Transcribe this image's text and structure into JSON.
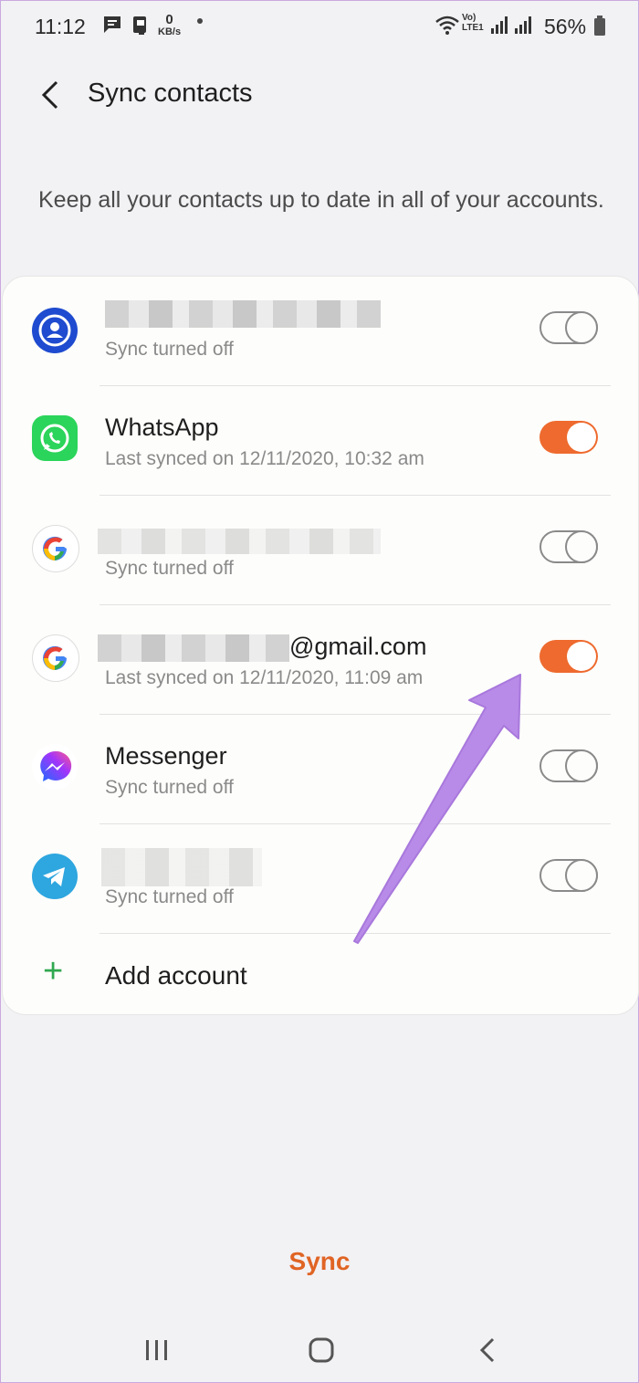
{
  "status_bar": {
    "time": "11:12",
    "speed_value": "0",
    "speed_unit": "KB/s",
    "network": "LTE1",
    "battery": "56%"
  },
  "header": {
    "title": "Sync contacts",
    "back_icon": "chevron-left-icon"
  },
  "description": "Keep all your contacts up to date in all of your accounts.",
  "accounts": [
    {
      "icon": "samsung-account-icon",
      "name": "",
      "status": "Sync turned off",
      "enabled": false
    },
    {
      "icon": "whatsapp-icon",
      "name": "WhatsApp",
      "status": "Last synced on 12/11/2020, 10:32 am",
      "enabled": true
    },
    {
      "icon": "google-icon",
      "name": "",
      "status": "Sync turned off",
      "enabled": false
    },
    {
      "icon": "google-icon",
      "name": "@gmail.com",
      "status": "Last synced on 12/11/2020, 11:09 am",
      "enabled": true
    },
    {
      "icon": "messenger-icon",
      "name": "Messenger",
      "status": "Sync turned off",
      "enabled": false
    },
    {
      "icon": "telegram-icon",
      "name": "",
      "status": "Sync turned off",
      "enabled": false
    }
  ],
  "add_account_label": "Add account",
  "sync_button_label": "Sync",
  "colors": {
    "accent": "#ee6a2e",
    "sync_text": "#e06424",
    "add_plus": "#2fa84f",
    "annotation_arrow": "#b98be8"
  }
}
